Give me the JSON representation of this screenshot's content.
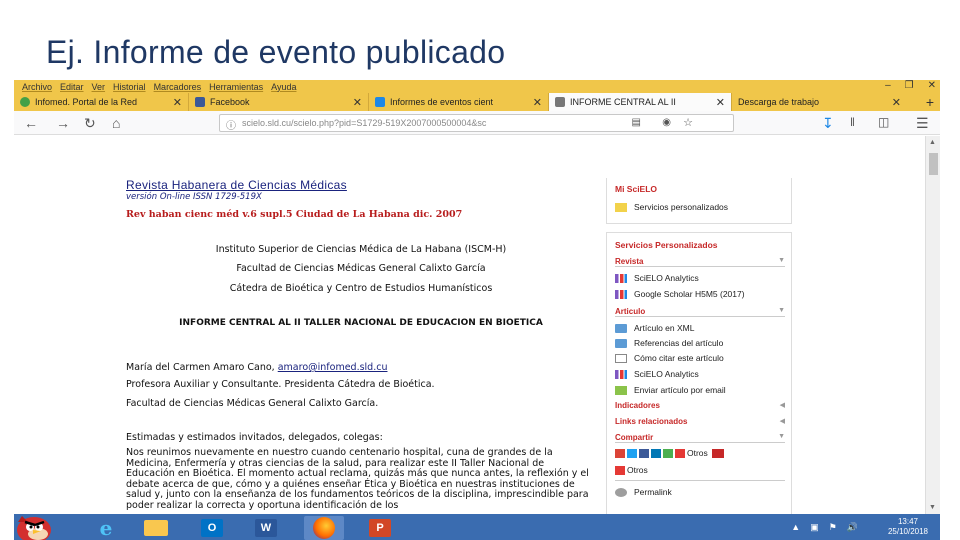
{
  "slide": {
    "title": "Ej. Informe de evento publicado"
  },
  "browser": {
    "menu": [
      "Archivo",
      "Editar",
      "Ver",
      "Historial",
      "Marcadores",
      "Herramientas",
      "Ayuda"
    ],
    "tabs": [
      {
        "label": "Infomed. Portal de la Red",
        "icon": "infomed-icon",
        "color": "#43a047"
      },
      {
        "label": "Facebook",
        "icon": "facebook-icon",
        "color": "#3b5998"
      },
      {
        "label": "Informes de eventos cient",
        "icon": "page-icon",
        "color": "#1e88e5"
      },
      {
        "label": "INFORME CENTRAL AL II",
        "icon": "page-icon",
        "color": "#555555"
      },
      {
        "label": "Descarga de trabajo",
        "icon": "download-icon",
        "color": "#888888"
      }
    ],
    "url": "scielo.sld.cu/scielo.php?pid=S1729-519X2007000500004&sc"
  },
  "article": {
    "journal_title": "Revista Habanera de Ciencias Médicas",
    "issn": "versión On-line ISSN 1729-519X",
    "issue": "Rev haban cienc méd v.6  supl.5 Ciudad de La Habana dic. 2007",
    "institute": "Instituto Superior de Ciencias Médica de La Habana (ISCM-H)",
    "faculty": "Facultad de Ciencias Médicas General Calixto García",
    "chair": "Cátedra de Bioética y Centro de Estudios Humanísticos",
    "heading": "INFORME CENTRAL AL II TALLER NACIONAL DE EDUCACION EN BIOETICA",
    "author_name": "María del Carmen Amaro Cano,",
    "author_email": "amaro@infomed.sld.cu",
    "author_role": "Profesora Auxiliar y Consultante. Presidenta Cátedra de Bioética.",
    "author_faculty": "Facultad de Ciencias Médicas General Calixto García.",
    "greeting": "Estimadas y estimados invitados, delegados, colegas:",
    "paragraph": "Nos reunimos nuevamente en nuestro cuando centenario hospital, cuna de grandes de la Medicina, Enfermería y otras ciencias de la salud, para realizar este II Taller Nacional de Educación en Bioética. El momento actual reclama, quizás más que nunca antes, la reflexión y el debate acerca de que, cómo y a quiénes enseñar Ética y Bioética en nuestras instituciones de salud y, junto con la enseñanza de los fundamentos teóricos de la disciplina, imprescindible para poder realizar la correcta y oportuna identificación de los"
  },
  "sidebar": {
    "mi_scielo": "Mi SciELO",
    "servicios_personalizados": "Servicios personalizados",
    "services_header": "Servicios Personalizados",
    "revista_label": "Revista",
    "revista_items": [
      "SciELO Analytics",
      "Google Scholar H5M5 (2017)"
    ],
    "articulo_label": "Articulo",
    "articulo_items": [
      "Artículo en XML",
      "Referencias del artículo",
      "Cómo citar este artículo",
      "SciELO Analytics",
      "Enviar artículo por email"
    ],
    "indicadores": "Indicadores",
    "links": "Links relacionados",
    "compartir": "Compartir",
    "otros_1": "Otros",
    "otros_2": "Otros",
    "permalink": "Permalink"
  },
  "taskbar": {
    "time": "13:47",
    "date": "25/10/2018"
  }
}
